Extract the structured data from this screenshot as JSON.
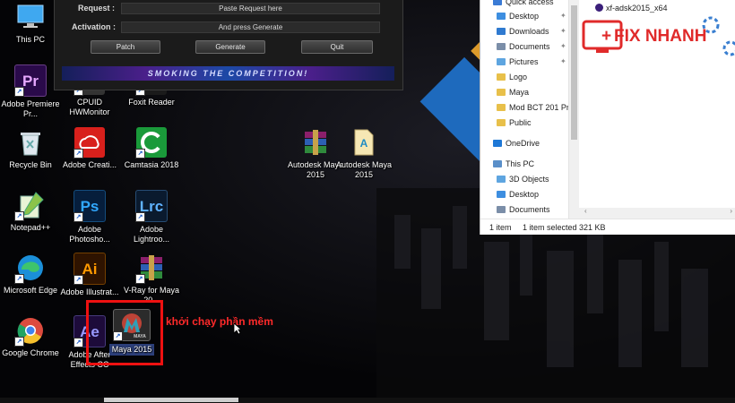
{
  "desktop_icons": [
    {
      "label": "This PC",
      "ic": "pc-icon"
    },
    {
      "label": "Adobe Premiere Pr...",
      "ic": "Pr",
      "color": "#2a0a4a",
      "fg": "#e7a8ff"
    },
    {
      "label": "Recycle Bin",
      "ic": "bin"
    },
    {
      "label": "Notepad++",
      "ic": "np"
    },
    {
      "label": "Microsoft Edge",
      "ic": "edge"
    },
    {
      "label": "Google Chrome",
      "ic": "chrome"
    },
    {
      "label": "CPUID HWMonitor",
      "ic": "hw"
    },
    {
      "label": "Adobe Creati...",
      "ic": "cc",
      "color": "#d8201c",
      "fg": "#fff"
    },
    {
      "label": "Adobe Photosho...",
      "ic": "Ps",
      "color": "#061e3c",
      "fg": "#31a8ff"
    },
    {
      "label": "Adobe Illustrat...",
      "ic": "Ai",
      "color": "#2e1300",
      "fg": "#ff9a00"
    },
    {
      "label": "Adobe After Effects CC",
      "ic": "Ae",
      "color": "#1d0b3a",
      "fg": "#9999ff"
    },
    {
      "label": "Foxit Reader",
      "ic": "fx"
    },
    {
      "label": "Camtasia 2018",
      "ic": "cam",
      "color": "#1a9a3a",
      "fg": "#fff"
    },
    {
      "label": "Adobe Lightroo...",
      "ic": "Lrc",
      "color": "#0a1a2e",
      "fg": "#5fb2ff"
    },
    {
      "label": "V-Ray for Maya 20...",
      "ic": "rar"
    },
    {
      "label": "Maya 2015",
      "ic": "maya"
    },
    {
      "label": "Autodesk Maya 2015",
      "ic": "rar"
    },
    {
      "label": "Autodesk Maya 2015",
      "ic": "doc"
    }
  ],
  "keygen": {
    "request_label": "Request :",
    "request_value": "Paste Request here",
    "activation_label": "Activation :",
    "activation_value": "And press Generate",
    "patch": "Patch",
    "generate": "Generate",
    "quit": "Quit",
    "banner": "SMOKING THE COMPETITION!"
  },
  "explorer": {
    "nav": [
      {
        "label": "Quick access",
        "pin": false,
        "color": "#3a7bd5"
      },
      {
        "label": "Desktop",
        "pin": true,
        "color": "#3d8ee0"
      },
      {
        "label": "Downloads",
        "pin": true,
        "color": "#2f7ad0"
      },
      {
        "label": "Documents",
        "pin": true,
        "color": "#7b8ea8"
      },
      {
        "label": "Pictures",
        "pin": true,
        "color": "#5ea5e0"
      },
      {
        "label": "Logo",
        "pin": false,
        "color": "#e8c04a"
      },
      {
        "label": "Maya",
        "pin": false,
        "color": "#e8c04a"
      },
      {
        "label": "Mod BCT 201 Pri",
        "pin": false,
        "color": "#e8c04a"
      },
      {
        "label": "Public",
        "pin": false,
        "color": "#e8c04a"
      },
      {
        "label": "OneDrive",
        "pin": false,
        "color": "#1e78d6"
      },
      {
        "label": "This PC",
        "pin": false,
        "color": "#5a8fc9"
      },
      {
        "label": "3D Objects",
        "pin": false,
        "color": "#5ea5e0"
      },
      {
        "label": "Desktop",
        "pin": false,
        "color": "#3d8ee0"
      },
      {
        "label": "Documents",
        "pin": false,
        "color": "#7b8ea8"
      }
    ],
    "file": "xf-adsk2015_x64",
    "status_items": "1 item",
    "status_selected": "1 item selected",
    "status_size": "321 KB"
  },
  "logo_text": "FIX NHANH",
  "annotation": "khởi chạy phần mềm"
}
